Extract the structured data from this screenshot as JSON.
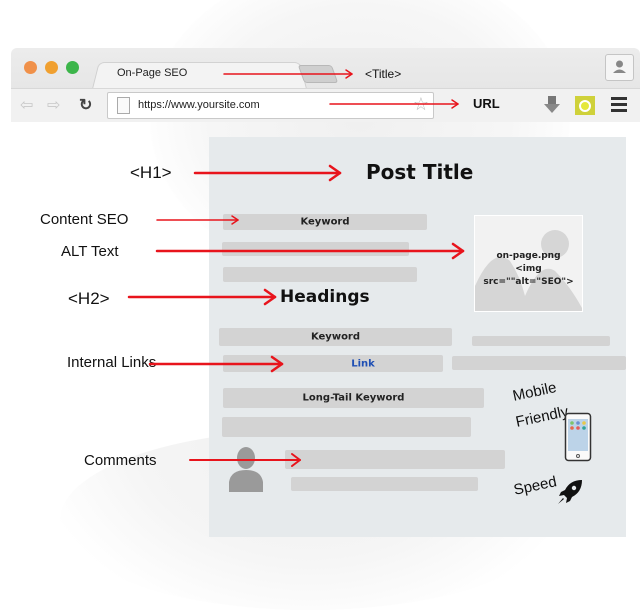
{
  "browser": {
    "tab_title": "On-Page SEO",
    "url": "https://www.yoursite.com",
    "traffic_lights": [
      "#f0914a",
      "#f0a030",
      "#3cb54a"
    ],
    "icons": [
      "back-arrow-icon",
      "forward-arrow-icon",
      "reload-icon",
      "page-icon",
      "star-icon",
      "download-icon",
      "extension-icon",
      "menu-icon",
      "profile-icon"
    ]
  },
  "annotations": {
    "title": "<Title>",
    "url": "URL",
    "h1": "<H1>",
    "content_seo": "Content SEO",
    "alt_text": "ALT Text",
    "h2": "<H2>",
    "internal_links": "Internal Links",
    "comments": "Comments",
    "mobile_friendly_1": "Mobile",
    "mobile_friendly_2": "Friendly",
    "speed": "Speed"
  },
  "page": {
    "post_title": "Post Title",
    "headings": "Headings",
    "keyword_1": "Keyword",
    "keyword_2": "Keyword",
    "link": "Link",
    "long_tail_keyword": "Long-Tail Keyword",
    "image_filename": "on-page.png",
    "image_tag": "<img src=\"\"alt=\"SEO\">"
  },
  "colors": {
    "arrow": "#e8141c",
    "link": "#1f4fb4",
    "panel": "#e6eaec",
    "bar": "#d3d3d3"
  }
}
